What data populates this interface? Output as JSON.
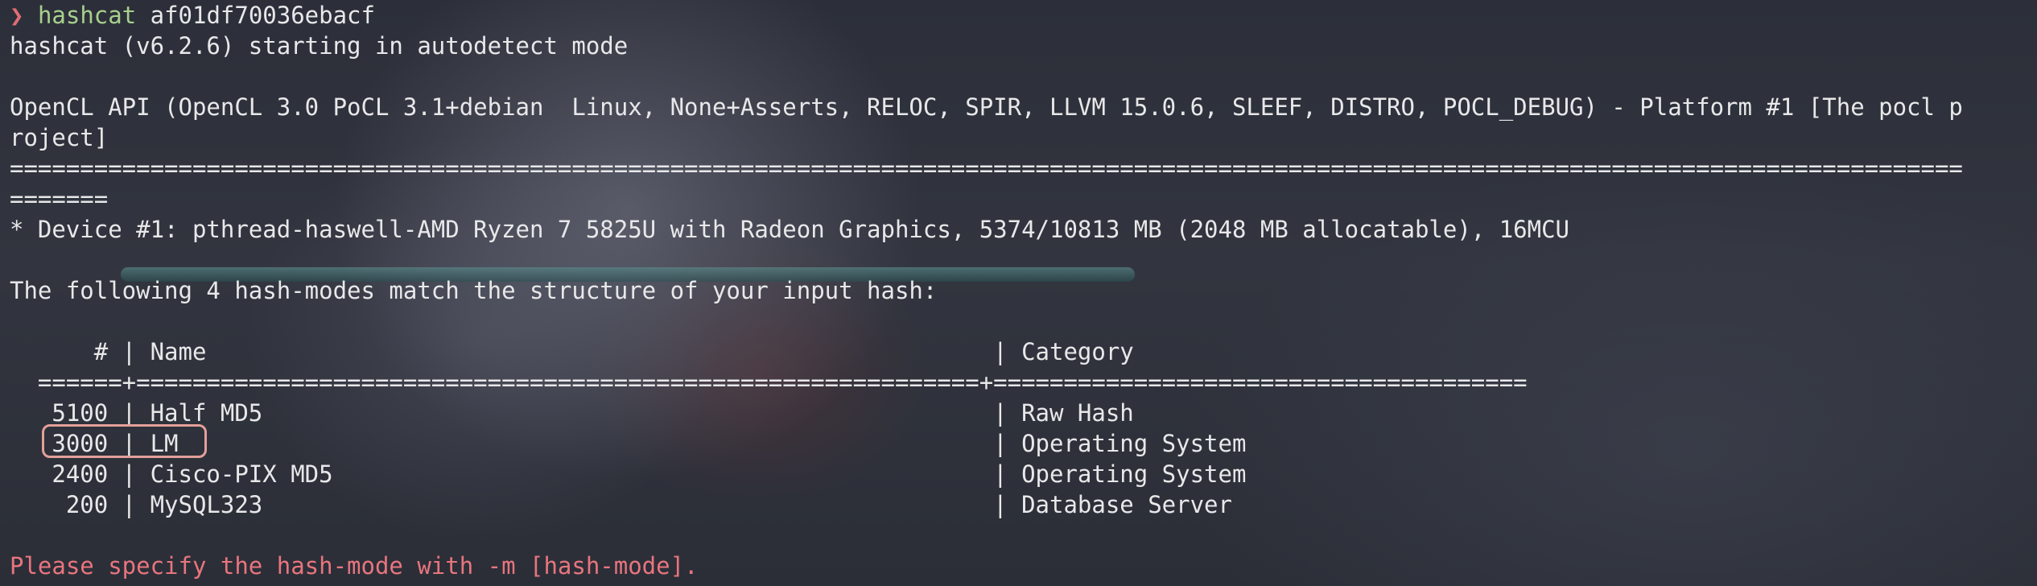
{
  "terminal": {
    "prompt_symbol": "❯",
    "command": "hashcat",
    "argument": " af01df70036ebacf",
    "start_line": "hashcat (v6.2.6) starting in autodetect mode",
    "opencl_line1": "OpenCL API (OpenCL 3.0 PoCL 3.1+debian  Linux, None+Asserts, RELOC, SPIR, LLVM 15.0.6, SLEEF, DISTRO, POCL_DEBUG) - Platform #1 [The pocl p",
    "opencl_line2": "roject]",
    "separator1": "===========================================================================================================================================",
    "separator2": "=======",
    "device_line": "* Device #1: pthread-haswell-AMD Ryzen 7 5825U with Radeon Graphics, 5374/10813 MB (2048 MB allocatable), 16MCU",
    "match_line": "The following 4 hash-modes match the structure of your input hash:",
    "table_header": "      # | Name                                                        | Category",
    "table_sep": "  ======+============================================================+======================================",
    "rows": [
      "   5100 | Half MD5                                                    | Raw Hash",
      "   3000 | LM                                                          | Operating System",
      "   2400 | Cisco-PIX MD5                                               | Operating System",
      "    200 | MySQL323                                                    | Database Server"
    ],
    "error_line": "Please specify the hash-mode with -m [hash-mode]."
  },
  "colors": {
    "prompt": "#e06c75",
    "command": "#a8d08d",
    "error": "#e8757e",
    "highlight": "#e3a09a"
  }
}
